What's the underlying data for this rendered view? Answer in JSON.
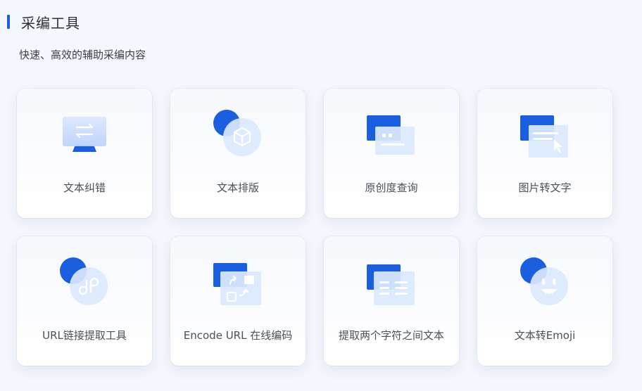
{
  "header": {
    "title": "采编工具",
    "subtitle": "快速、高效的辅助采编内容"
  },
  "tools": [
    {
      "label": "文本纠错",
      "icon": "monitor-swap-icon"
    },
    {
      "label": "文本排版",
      "icon": "cube-layout-icon"
    },
    {
      "label": "原创度查询",
      "icon": "window-search-icon"
    },
    {
      "label": "图片转文字",
      "icon": "image-to-text-icon"
    },
    {
      "label": "URL链接提取工具",
      "icon": "link-icon"
    },
    {
      "label": "Encode URL 在线编码",
      "icon": "encode-url-icon"
    },
    {
      "label": "提取两个字符之间文本",
      "icon": "text-extract-icon"
    },
    {
      "label": "文本转Emoji",
      "icon": "emoji-icon"
    }
  ],
  "colors": {
    "accent": "#1d5fd6",
    "icon_dark": "#1a5fe0",
    "icon_light": "#cfe0fb"
  }
}
